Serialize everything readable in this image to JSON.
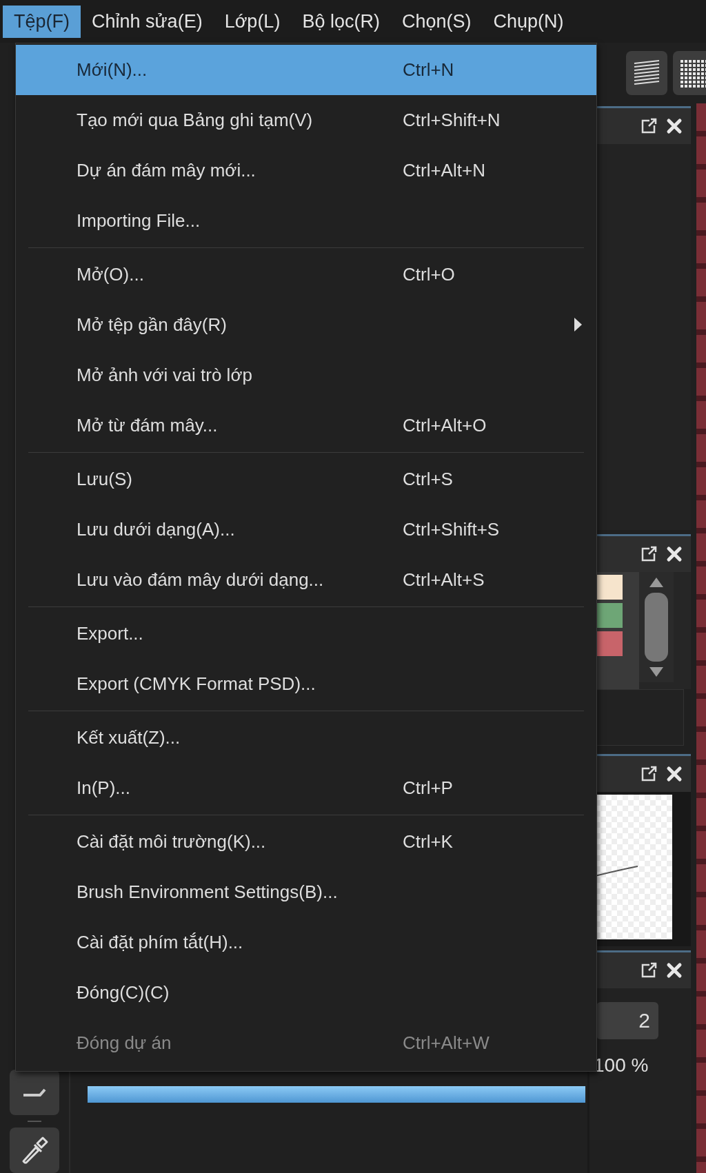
{
  "menubar": [
    {
      "label": "Tệp(F)",
      "selected": true
    },
    {
      "label": "Chỉnh sửa(E)",
      "selected": false
    },
    {
      "label": "Lớp(L)",
      "selected": false
    },
    {
      "label": "Bộ lọc(R)",
      "selected": false
    },
    {
      "label": "Chọn(S)",
      "selected": false
    },
    {
      "label": "Chụp(N)",
      "selected": false
    }
  ],
  "file_menu": [
    [
      {
        "label": "Mới(N)...",
        "shortcut": "Ctrl+N",
        "submenu": false,
        "disabled": false,
        "selected": true
      },
      {
        "label": "Tạo mới qua Bảng ghi tạm(V)",
        "shortcut": "Ctrl+Shift+N",
        "submenu": false,
        "disabled": false,
        "selected": false
      },
      {
        "label": "Dự án đám mây mới...",
        "shortcut": "Ctrl+Alt+N",
        "submenu": false,
        "disabled": false,
        "selected": false
      },
      {
        "label": "Importing File...",
        "submenu": false,
        "disabled": false,
        "selected": false
      }
    ],
    [
      {
        "label": "Mở(O)...",
        "shortcut": "Ctrl+O",
        "submenu": false,
        "disabled": false,
        "selected": false
      },
      {
        "label": "Mở tệp gần đây(R)",
        "submenu": true,
        "disabled": false,
        "selected": false
      },
      {
        "label": "Mở ảnh với vai trò lớp",
        "submenu": false,
        "disabled": false,
        "selected": false
      },
      {
        "label": "Mở từ đám mây...",
        "shortcut": "Ctrl+Alt+O",
        "submenu": false,
        "disabled": false,
        "selected": false
      }
    ],
    [
      {
        "label": "Lưu(S)",
        "shortcut": "Ctrl+S",
        "submenu": false,
        "disabled": false,
        "selected": false
      },
      {
        "label": "Lưu dưới dạng(A)...",
        "shortcut": "Ctrl+Shift+S",
        "submenu": false,
        "disabled": false,
        "selected": false
      },
      {
        "label": "Lưu vào đám mây dưới dạng...",
        "shortcut": "Ctrl+Alt+S",
        "submenu": false,
        "disabled": false,
        "selected": false
      }
    ],
    [
      {
        "label": "Export...",
        "submenu": false,
        "disabled": false,
        "selected": false
      },
      {
        "label": "Export (CMYK Format PSD)...",
        "submenu": false,
        "disabled": false,
        "selected": false
      }
    ],
    [
      {
        "label": "Kết xuất(Z)...",
        "submenu": false,
        "disabled": false,
        "selected": false
      },
      {
        "label": "In(P)...",
        "shortcut": "Ctrl+P",
        "submenu": false,
        "disabled": false,
        "selected": false
      }
    ],
    [
      {
        "label": "Cài đặt môi trường(K)...",
        "shortcut": "Ctrl+K",
        "submenu": false,
        "disabled": false,
        "selected": false
      },
      {
        "label": "Brush Environment Settings(B)...",
        "submenu": false,
        "disabled": false,
        "selected": false
      },
      {
        "label": "Cài đặt phím tắt(H)...",
        "submenu": false,
        "disabled": false,
        "selected": false
      },
      {
        "label": "Đóng(C)(C)",
        "submenu": false,
        "disabled": false,
        "selected": false
      },
      {
        "label": "Đóng dự án",
        "shortcut": "Ctrl+Alt+W",
        "submenu": false,
        "disabled": true,
        "selected": false
      }
    ]
  ],
  "panels": [
    {
      "kind": "empty"
    },
    {
      "kind": "swatches",
      "swatches": [
        {
          "color": "#f6e4cc"
        },
        {
          "color": "#6ea676"
        },
        {
          "color": "#c8646a"
        }
      ]
    },
    {
      "kind": "preview"
    },
    {
      "kind": "settings",
      "value": "2",
      "reading": "100 %"
    }
  ],
  "opacity_slider": {
    "level": 1
  }
}
